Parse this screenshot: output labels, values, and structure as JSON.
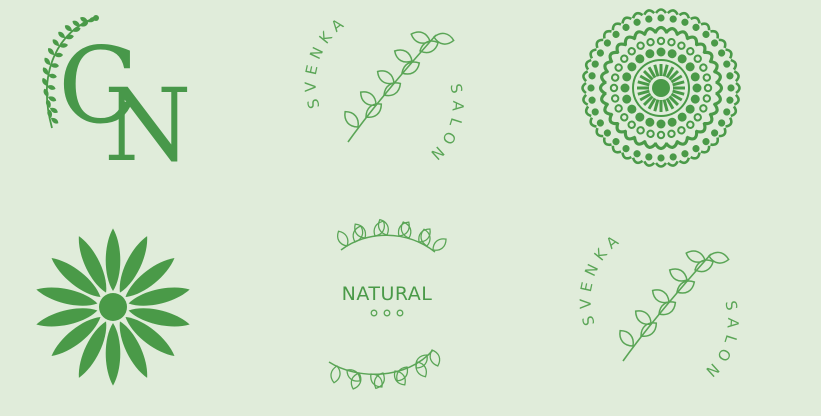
{
  "colors": {
    "background": "#e0ecda",
    "primary": "#4a9a48",
    "line": "#5aa556"
  },
  "logos": [
    {
      "kind": "monogram",
      "letter1": "C",
      "letter2": "N"
    },
    {
      "kind": "salon-badge",
      "top_text": "SVENKA",
      "bottom_text": "SALON"
    },
    {
      "kind": "mandala"
    },
    {
      "kind": "flower"
    },
    {
      "kind": "natural-wreath",
      "label": "NATURAL"
    },
    {
      "kind": "salon-badge",
      "top_text": "SVENKA",
      "bottom_text": "SALON"
    }
  ]
}
